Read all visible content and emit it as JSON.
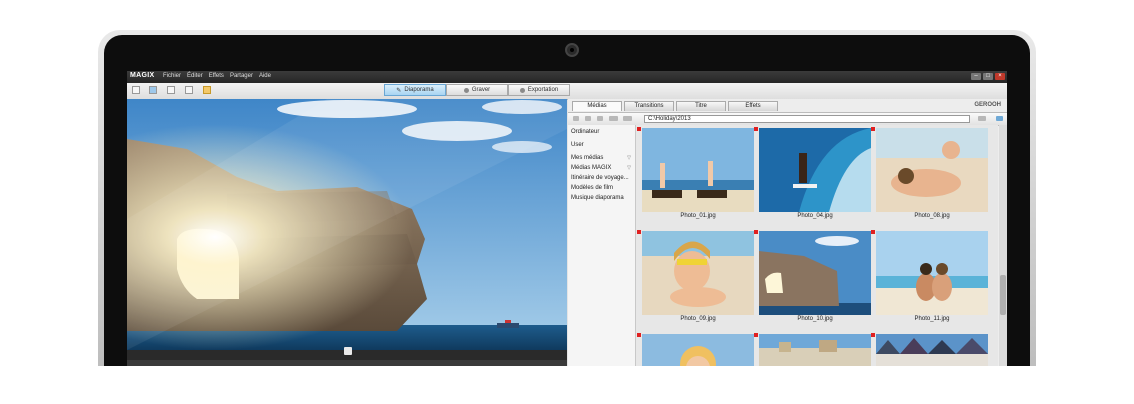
{
  "app": {
    "logo": "MAGIX",
    "menu": [
      "Fichier",
      "Éditer",
      "Effets",
      "Partager",
      "Aide"
    ]
  },
  "modes": [
    {
      "label": "Diaporama",
      "active": true
    },
    {
      "label": "Graver",
      "active": false
    },
    {
      "label": "Exportation",
      "active": false
    }
  ],
  "media_tabs": [
    {
      "label": "Médias",
      "active": true
    },
    {
      "label": "Transitions",
      "active": false
    },
    {
      "label": "Titre",
      "active": false
    },
    {
      "label": "Effets",
      "active": false
    }
  ],
  "brand": "GEROOH",
  "path": "C:\\Holiday\\2013",
  "tree": [
    {
      "label": "Ordinateur",
      "expandable": false
    },
    {
      "label": "User",
      "expandable": false
    },
    {
      "label": "Mes médias",
      "expandable": true
    },
    {
      "label": "Médias MAGIX",
      "expandable": true
    },
    {
      "label": "Itinéraire de voyage...",
      "expandable": false
    },
    {
      "label": "Modèles de film",
      "expandable": false
    },
    {
      "label": "Musique diaporama",
      "expandable": false
    }
  ],
  "photos": [
    {
      "name": "Photo_01.jpg",
      "scene": "beach-chairs"
    },
    {
      "name": "Photo_04.jpg",
      "scene": "surfer"
    },
    {
      "name": "Photo_08.jpg",
      "scene": "mother-child"
    },
    {
      "name": "Photo_09.jpg",
      "scene": "girl-snorkel"
    },
    {
      "name": "Photo_10.jpg",
      "scene": "rock-arch"
    },
    {
      "name": "Photo_11.jpg",
      "scene": "couple-beach"
    },
    {
      "name": "",
      "scene": "child"
    },
    {
      "name": "",
      "scene": "town"
    },
    {
      "name": "",
      "scene": "houses"
    }
  ],
  "colors": {
    "accent": "#a9d4f2",
    "marker": "#e02020",
    "sky": "#3f86c8"
  }
}
